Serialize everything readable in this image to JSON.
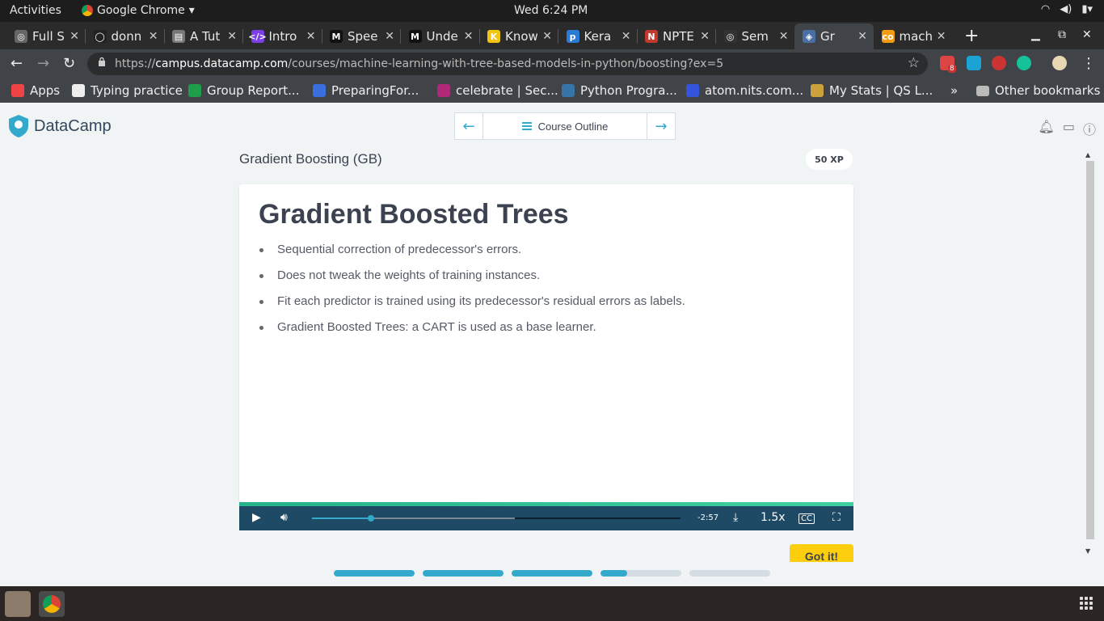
{
  "system": {
    "activities": "Activities",
    "app_name": "Google Chrome",
    "clock": "Wed  6:24 PM"
  },
  "tabs": [
    {
      "title": "Full S",
      "active": false
    },
    {
      "title": "donn",
      "active": false
    },
    {
      "title": "A Tut",
      "active": false
    },
    {
      "title": "Intro",
      "active": false
    },
    {
      "title": "Spee",
      "active": false
    },
    {
      "title": "Unde",
      "active": false
    },
    {
      "title": "Know",
      "active": false
    },
    {
      "title": "Kera",
      "active": false
    },
    {
      "title": "NPTE",
      "active": false
    },
    {
      "title": "Sem",
      "active": false
    },
    {
      "title": "Gr",
      "active": true
    },
    {
      "title": "mach",
      "active": false
    }
  ],
  "address_bar": {
    "prefix": "https://",
    "host": "campus.datacamp.com",
    "path": "/courses/machine-learning-with-tree-based-models-in-python/boosting?ex=5",
    "ext_badge": "8"
  },
  "bookmarks": [
    {
      "label": "Apps"
    },
    {
      "label": "Typing practice"
    },
    {
      "label": "Group Report..."
    },
    {
      "label": "PreparingFor..."
    },
    {
      "label": "celebrate | Sec..."
    },
    {
      "label": "Python Progra..."
    },
    {
      "label": "atom.nits.com..."
    },
    {
      "label": "My Stats | QS L..."
    }
  ],
  "bookmarks_more": "»",
  "other_bookmarks": "Other bookmarks",
  "datacamp": {
    "logo": "DataCamp",
    "course_outline": "Course Outline",
    "exercise_title": "Gradient Boosting (GB)",
    "xp": "50 XP",
    "got_it": "Got it!"
  },
  "slide": {
    "heading": "Gradient Boosted Trees",
    "bullets": [
      "Sequential correction of predecessor's errors.",
      "Does not tweak the weights of training instances.",
      "Fit each predictor is trained using its predecessor's residual errors as labels.",
      "Gradient Boosted Trees: a CART is used as a base learner."
    ]
  },
  "player": {
    "time_remaining": "-2:57",
    "playback_rate": "1.5x",
    "played_fraction": 0.16,
    "buffered_fraction": 0.55
  },
  "progress_dots": [
    1.0,
    1.0,
    1.0,
    0.33,
    0.0
  ],
  "colors": {
    "accent": "#33aacc",
    "player_bg": "#1e4a66",
    "got_it": "#fcce0d",
    "progress_green": "#24b38a"
  }
}
